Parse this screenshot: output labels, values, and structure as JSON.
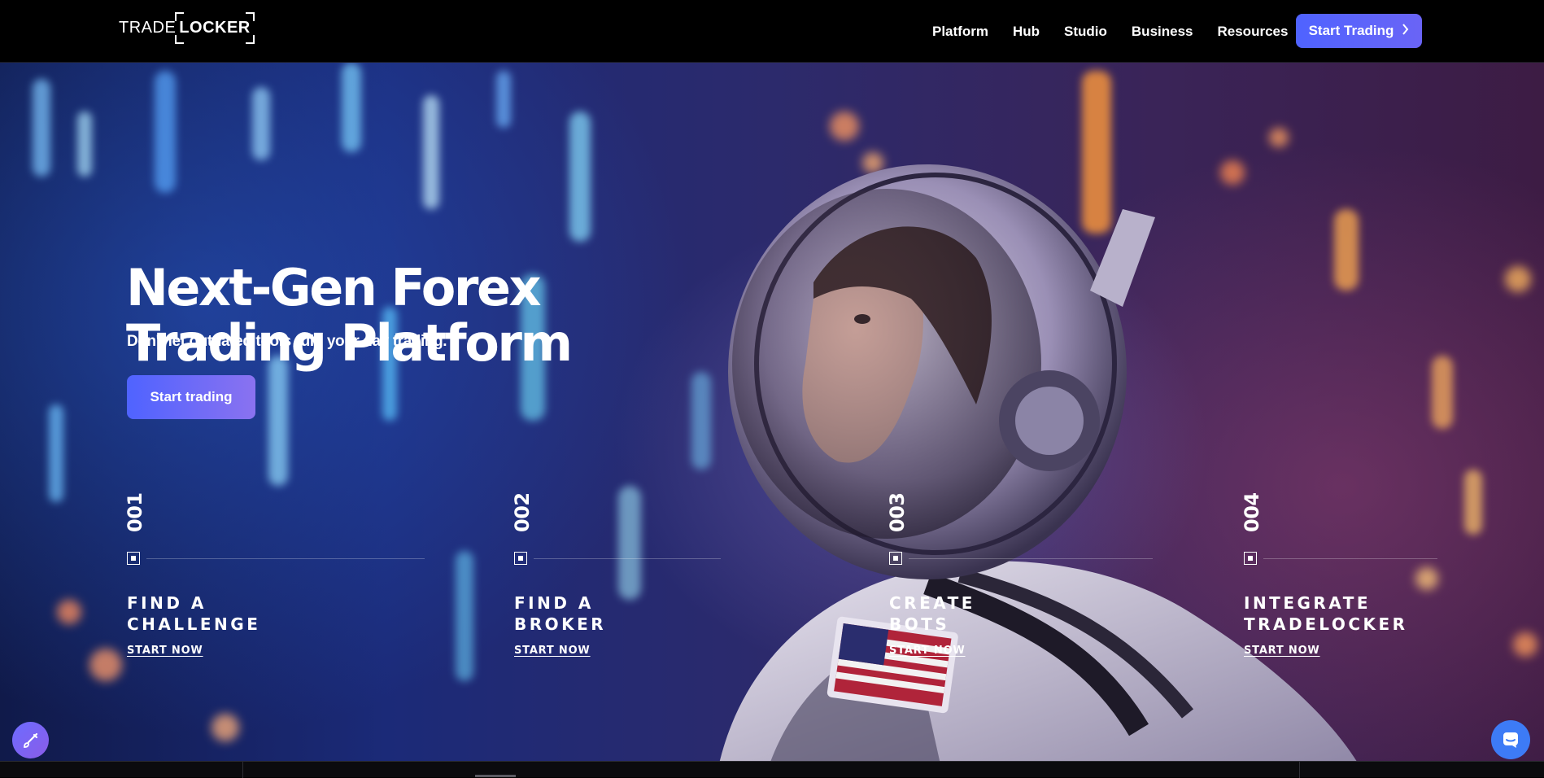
{
  "header": {
    "logo": {
      "trade": "TRADE",
      "locker": "LOCKER"
    },
    "nav": [
      {
        "label": "Platform"
      },
      {
        "label": "Hub"
      },
      {
        "label": "Studio"
      },
      {
        "label": "Business"
      },
      {
        "label": "Resources"
      }
    ],
    "cta_label": "Start Trading",
    "cta_icon": "chevron-right-icon"
  },
  "hero": {
    "title_line1": "Next-Gen Forex",
    "title_line2": "Trading Platform",
    "subtitle": "Don't let outdated tools ruin your day trading.",
    "cta_label": "Start trading",
    "background": "astronaut-looking-up-city-lights"
  },
  "steps": [
    {
      "number": "001",
      "title": "FIND A\nCHALLENGE",
      "link": "START NOW"
    },
    {
      "number": "002",
      "title": "FIND A\nBROKER",
      "link": "START NOW"
    },
    {
      "number": "003",
      "title": "CREATE\nBOTS",
      "link": "START NOW"
    },
    {
      "number": "004",
      "title": "INTEGRATE\nTRADELOCKER",
      "link": "START NOW"
    }
  ],
  "floating": {
    "left_icon": "brush-icon",
    "right_icon": "chat-icon"
  },
  "colors": {
    "accent": "#4f63ff",
    "accent_end": "#8a72f0",
    "header_bg": "#000000",
    "chat_button": "#3d7bf6"
  }
}
